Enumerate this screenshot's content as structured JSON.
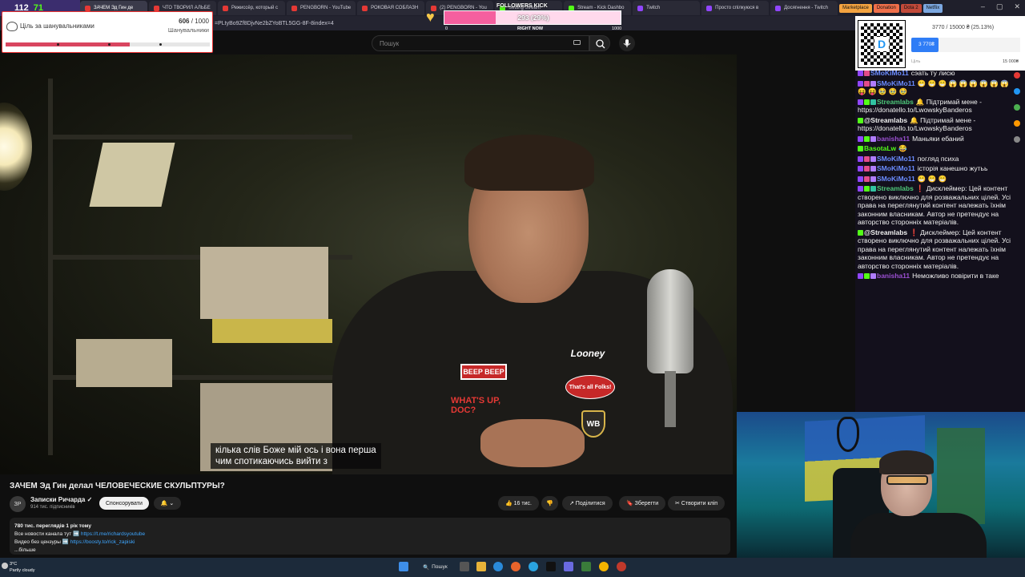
{
  "badges": {
    "left_count": "112",
    "kick_count": "71"
  },
  "browser": {
    "tabs": [
      {
        "label": "ЗАЧЕМ Эд Гин де",
        "type": "yt",
        "active": true
      },
      {
        "label": "ЧТО ТВОРИЛ АЛЬБЕ",
        "type": "yt"
      },
      {
        "label": "Режиссёр, который с",
        "type": "yt"
      },
      {
        "label": "PENGBORN - YouTube",
        "type": "yt"
      },
      {
        "label": "РОКОВАЯ СОБЛАЗН",
        "type": "yt"
      },
      {
        "label": "(2) PENGBORN - You",
        "type": "yt"
      },
      {
        "label": "Setting Stream",
        "type": "kk"
      },
      {
        "label": "Stream - Kick Dashbo",
        "type": "kk"
      },
      {
        "label": "Twitch",
        "type": "tw"
      },
      {
        "label": "Просто спілкуюся в",
        "type": "tw"
      },
      {
        "label": "Досягнення - Twitch",
        "type": "tw"
      }
    ],
    "bookmarks": [
      {
        "label": "Marketplace",
        "color": "#f4a340"
      },
      {
        "label": "Donation",
        "color": "#f06f4a"
      },
      {
        "label": "Dota 2",
        "color": "#c24a3a"
      },
      {
        "label": "Netflix",
        "color": "#7ba7e0"
      }
    ],
    "url_fragment": "=PLtyBo9Zf8DjvNe2bZYoBTL5GG-8F-8index=4",
    "window_controls": [
      "–",
      "▢",
      "✕"
    ]
  },
  "youtube": {
    "search_placeholder": "Пошук",
    "video": {
      "subtitle_line1": "кілька слів Боже мій ось і вона перша",
      "subtitle_line2": "чим спотикаючись вийти з",
      "patches": [
        "BEEP BEEP",
        "WHAT'S UP, DOC?",
        "Looney",
        "That's all Folks!",
        "WB"
      ]
    },
    "title": "ЗАЧЕМ Эд Гин делал ЧЕЛОВЕЧЕСКИЕ СКУЛЬПТУРЫ?",
    "channel": {
      "avatar_text": "ЗР",
      "name": "Записки Ричарда ✓",
      "subscribers": "914 тис. підписників",
      "sponsor_label": "Спонсорувати",
      "bell_label": "🔔 ⌄"
    },
    "actions": {
      "like": "👍 16 тис.",
      "dislike": "👎",
      "share": "↗ Поділитися",
      "save": "🔖 Зберегти",
      "clip": "✂ Створити кліп"
    },
    "description": {
      "stats": "780 тис. переглядів  1 рік тому",
      "line1_text": "Все новости канала тут ➡️ ",
      "line1_link": "https://t.me/richardsyoutube",
      "line2_text": "Видео без цензуры ➡️ ",
      "line2_link": "https://boosty.to/rick_zapiski",
      "more": "...більше"
    }
  },
  "goal_widget": {
    "label": "Ціль за шанувальниками",
    "current": "606",
    "target": "/ 1000",
    "sublabel": "Шанувальники",
    "progress": 0.606
  },
  "followers_kick": {
    "title": "FOLLOWERS KICK",
    "value_text": "293 (29%)",
    "progress": 0.293,
    "min": "0",
    "mid": "RIGHT NOW",
    "max": "1000"
  },
  "donation_widget": {
    "total": "3770 / 15000 ₴ (25.13%)",
    "current": "3 770₴",
    "left_label": "Ціль",
    "right_label": "15 000₴",
    "progress": 0.2513,
    "qr_letter": "D"
  },
  "chat": [
    {
      "nick": "SMoKiMo11",
      "color": "#6b8cff",
      "icons": [
        "#9146ff",
        "#e24c8a"
      ],
      "text": "сэать ту лисю"
    },
    {
      "nick": "SMoKiMo11",
      "color": "#6b8cff",
      "icons": [
        "#9146ff",
        "#e24c8a",
        "#b07cff"
      ],
      "text": "😁 😁 😁 😱 😱 😱 😱 😱 😱 😝 😝 🥹 🥹 🥹"
    },
    {
      "nick": "Streamlabs",
      "color": "#4ec97a",
      "icons": [
        "#9146ff",
        "#53fc18",
        "#31c3a2"
      ],
      "text": "🔔 Підтримай мене - https://donatello.to/LwowskyBanderos"
    },
    {
      "nick": "@Streamlabs",
      "color": "#f1f1f1",
      "icons": [
        "#53fc18"
      ],
      "text": "🔔 Підтримай мене - https://donatello.to/LwowskyBanderos"
    },
    {
      "nick": "banisha11",
      "color": "#9a4fd1",
      "icons": [
        "#9146ff",
        "#53fc18",
        "#b07cff"
      ],
      "text": "Маньяки ебаний"
    },
    {
      "nick": "BasotaLw",
      "color": "#53fc18",
      "icons": [
        "#53fc18"
      ],
      "text": "😂"
    },
    {
      "nick": "SMoKiMo11",
      "color": "#6b8cff",
      "icons": [
        "#9146ff",
        "#e24c8a",
        "#b07cff"
      ],
      "text": "погляд психа"
    },
    {
      "nick": "SMoKiMo11",
      "color": "#6b8cff",
      "icons": [
        "#9146ff",
        "#e24c8a",
        "#b07cff"
      ],
      "text": "історія канешно жутьь"
    },
    {
      "nick": "SMoKiMo11",
      "color": "#6b8cff",
      "icons": [
        "#9146ff",
        "#e24c8a",
        "#b07cff"
      ],
      "text": "😁 😁 😁"
    },
    {
      "nick": "Streamlabs",
      "color": "#4ec97a",
      "icons": [
        "#9146ff",
        "#53fc18",
        "#31c3a2"
      ],
      "text": "❗ Дисклеймер: Цей контент створено виключно для розважальних цілей. Усі права на переглянутий контент належать їхнім законним власникам. Автор не претендує на авторство сторонніх матеріалів."
    },
    {
      "nick": "@Streamlabs",
      "color": "#f1f1f1",
      "icons": [
        "#53fc18"
      ],
      "text": "❗ Дисклеймер: Цей контент створено виключно для розважальних цілей. Усі права на переглянутий контент належать їхнім законним власникам. Автор не претендує на авторство сторонніх матеріалів."
    },
    {
      "nick": "banisha11",
      "color": "#9a4fd1",
      "icons": [
        "#9146ff",
        "#53fc18",
        "#b07cff"
      ],
      "text": "Неможливо повірити в таке"
    }
  ],
  "taskbar": {
    "weather_temp": "3°C",
    "weather_desc": "Partly cloudy",
    "search_label": "Пошук"
  }
}
